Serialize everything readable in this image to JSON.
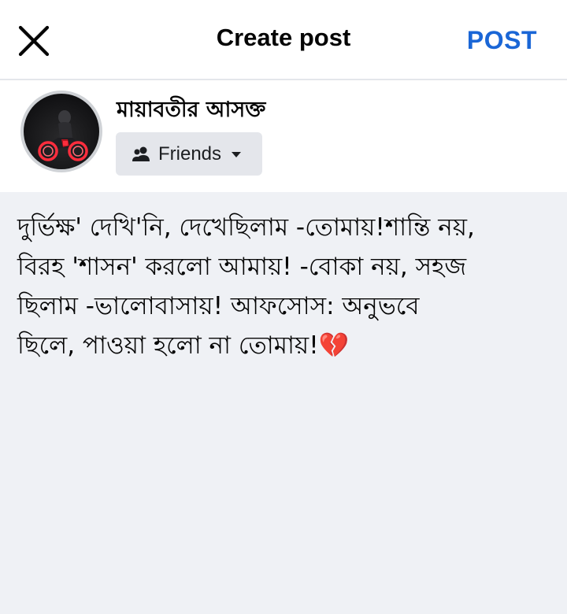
{
  "header": {
    "title": "Create post",
    "post_label": "POST",
    "close_icon": "close-icon"
  },
  "user": {
    "name": "মায়াবতীর আসক্ত",
    "avatar_icon": "motorcycle-rider-avatar"
  },
  "audience": {
    "label": "Friends",
    "icon": "friends-icon",
    "caret_icon": "caret-down-icon"
  },
  "composer": {
    "text": "দুর্ভিক্ষ' দেখি'নি, দেখেছিলাম -তোমায়!শান্তি নয়,\nবিরহ 'শাসন' করলো আমায়! -বোকা নয়, সহজ\nছিলাম -ভালোবাসায়! আফসোস: অনুভবে\nছিলে, পাওয়া হলো না তোমায়!💔"
  },
  "colors": {
    "accent": "#1a66d6",
    "composer_bg": "#eff1f5",
    "audience_bg": "#e4e6eb",
    "avatar_neon": "#ff2d3d"
  }
}
